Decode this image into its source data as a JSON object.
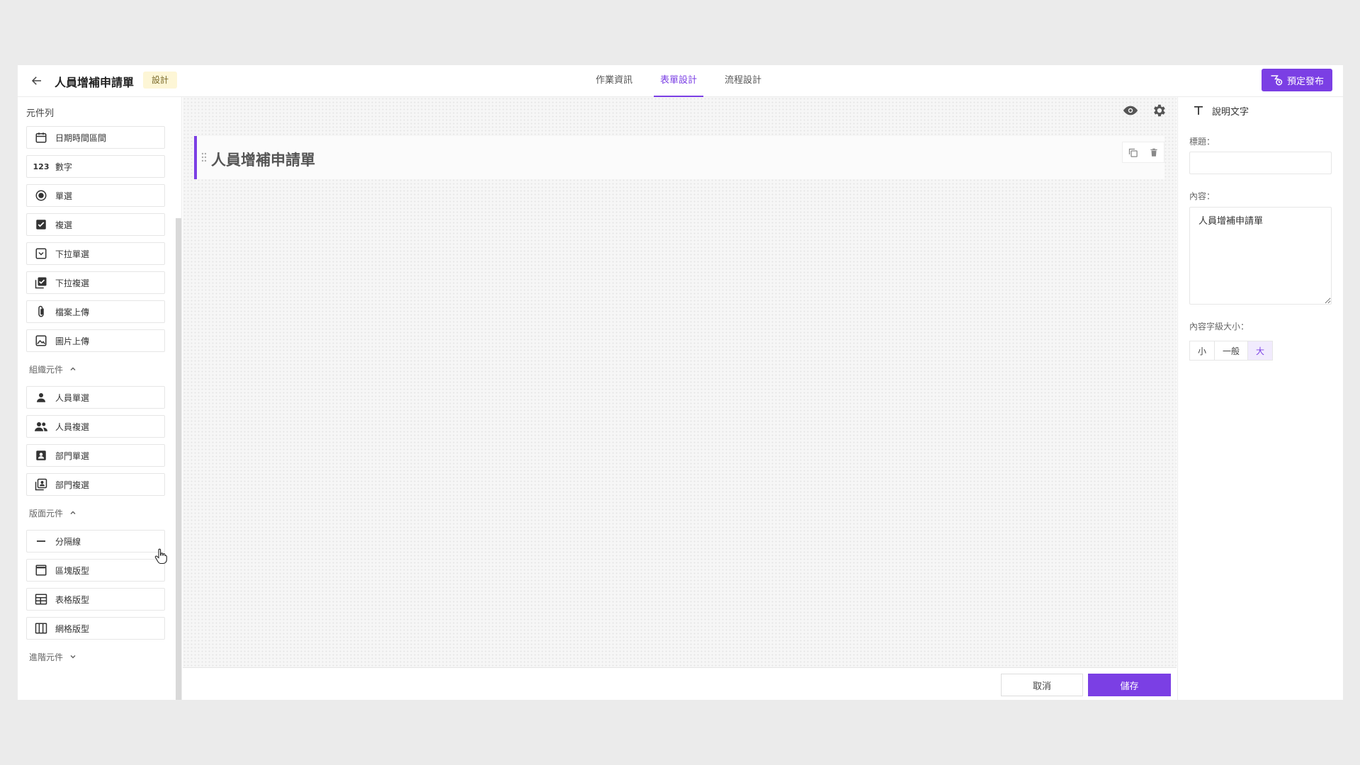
{
  "header": {
    "title": "人員增補申請單",
    "mode_badge": "設計",
    "tabs": [
      {
        "label": "作業資訊"
      },
      {
        "label": "表單設計"
      },
      {
        "label": "流程設計"
      }
    ],
    "active_tab": "表單設計",
    "publish_label": "預定發布"
  },
  "left_panel": {
    "title": "元件列",
    "basic_items": [
      {
        "label": "日期時間區間",
        "icon": "calendar-icon"
      },
      {
        "label": "數字",
        "icon": "number-icon"
      },
      {
        "label": "單選",
        "icon": "radio-icon"
      },
      {
        "label": "複選",
        "icon": "checkbox-icon"
      },
      {
        "label": "下拉單選",
        "icon": "dropdown-single-icon"
      },
      {
        "label": "下拉複選",
        "icon": "dropdown-multi-icon"
      },
      {
        "label": "檔案上傳",
        "icon": "paperclip-icon"
      },
      {
        "label": "圖片上傳",
        "icon": "image-icon"
      }
    ],
    "org_group": {
      "label": "組織元件",
      "items": [
        {
          "label": "人員單選",
          "icon": "person-icon"
        },
        {
          "label": "人員複選",
          "icon": "people-icon"
        },
        {
          "label": "部門單選",
          "icon": "department-icon"
        },
        {
          "label": "部門複選",
          "icon": "departments-icon"
        }
      ]
    },
    "layout_group": {
      "label": "版面元件",
      "items": [
        {
          "label": "分隔線",
          "icon": "divider-icon"
        },
        {
          "label": "區塊版型",
          "icon": "block-layout-icon"
        },
        {
          "label": "表格版型",
          "icon": "table-layout-icon"
        },
        {
          "label": "網格版型",
          "icon": "grid-layout-icon"
        }
      ]
    },
    "advanced_group": {
      "label": "進階元件"
    }
  },
  "canvas": {
    "form_title": "人員增補申請單"
  },
  "footer": {
    "cancel_label": "取消",
    "save_label": "儲存"
  },
  "right_panel": {
    "header": "說明文字",
    "title_label": "標題：",
    "title_value": "",
    "content_label": "內容：",
    "content_value": "人員增補申請單",
    "font_size_label": "內容字級大小：",
    "font_size_options": [
      "小",
      "一般",
      "大"
    ],
    "font_size_selected": "大"
  },
  "colors": {
    "accent": "#7b3fe4",
    "badge_bg": "#fdf6d6"
  }
}
